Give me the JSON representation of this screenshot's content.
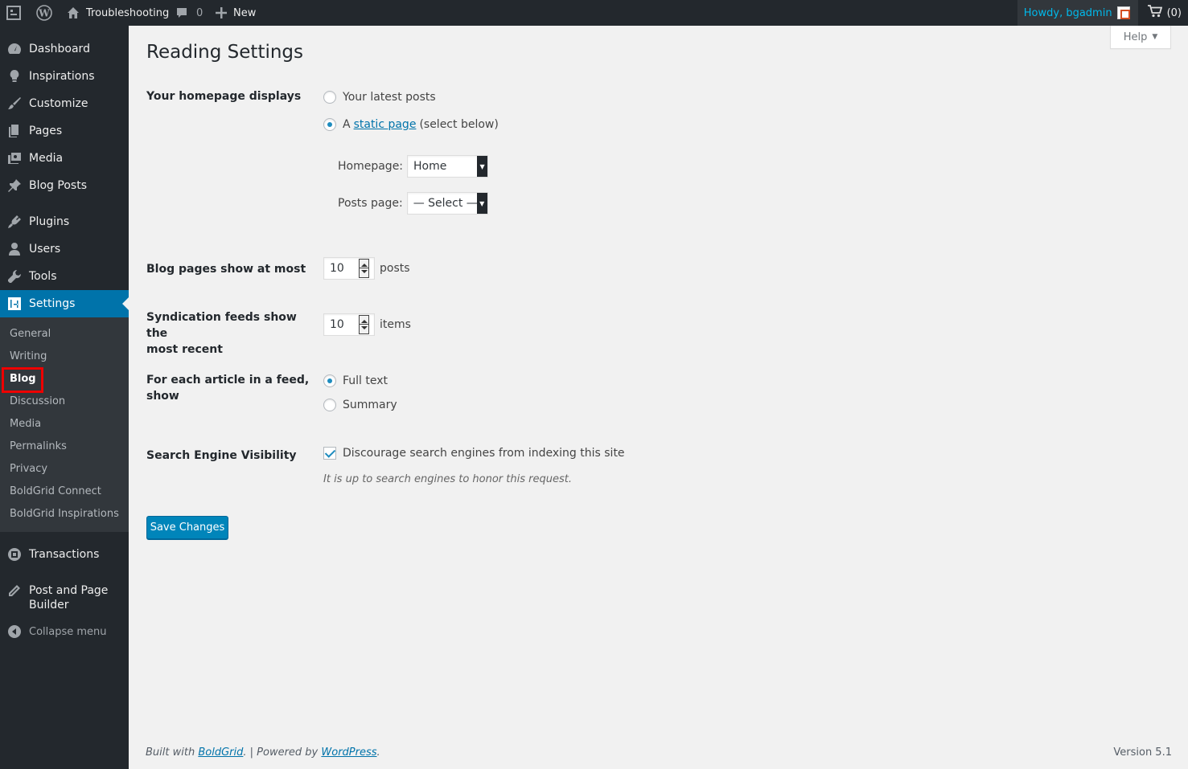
{
  "adminbar": {
    "site_name": "Troubleshooting",
    "comments_count": "0",
    "new_label": "New",
    "howdy": "Howdy, bgadmin",
    "cart_count": "(0)"
  },
  "sidebar": {
    "items": [
      {
        "label": "Dashboard",
        "icon": "dashboard-icon"
      },
      {
        "label": "Inspirations",
        "icon": "lightbulb-icon"
      },
      {
        "label": "Customize",
        "icon": "brush-icon"
      },
      {
        "label": "Pages",
        "icon": "pages-icon"
      },
      {
        "label": "Media",
        "icon": "media-icon"
      },
      {
        "label": "Blog Posts",
        "icon": "pin-icon"
      },
      {
        "label": "Plugins",
        "icon": "plugin-icon"
      },
      {
        "label": "Users",
        "icon": "user-icon"
      },
      {
        "label": "Tools",
        "icon": "wrench-icon"
      },
      {
        "label": "Settings",
        "icon": "settings-icon"
      }
    ],
    "submenu": [
      "General",
      "Writing",
      "Blog",
      "Discussion",
      "Media",
      "Permalinks",
      "Privacy",
      "BoldGrid Connect",
      "BoldGrid Inspirations"
    ],
    "transactions": "Transactions",
    "builder_line1": "Post and Page",
    "builder_line2": "Builder",
    "collapse": "Collapse menu"
  },
  "page": {
    "help": "Help",
    "title": "Reading Settings",
    "homepage_displays": {
      "label": "Your homepage displays",
      "opt_latest": "Your latest posts",
      "opt_static_prefix": "A",
      "opt_static_link": "static page",
      "opt_static_suffix": "(select below)",
      "homepage_label": "Homepage:",
      "homepage_value": "Home",
      "posts_page_label": "Posts page:",
      "posts_page_value": "— Select —"
    },
    "blog_pages": {
      "label": "Blog pages show at most",
      "value": "10",
      "unit": "posts"
    },
    "syndication": {
      "label_line1": "Syndication feeds show the",
      "label_line2": "most recent",
      "value": "10",
      "unit": "items"
    },
    "feed_article": {
      "label": "For each article in a feed, show",
      "opt_full": "Full text",
      "opt_summary": "Summary"
    },
    "search_visibility": {
      "label": "Search Engine Visibility",
      "checkbox": "Discourage search engines from indexing this site",
      "description": "It is up to search engines to honor this request."
    },
    "save": "Save Changes"
  },
  "footer": {
    "built_with": "Built with",
    "boldgrid": "BoldGrid",
    "powered_by": ". | Powered by",
    "wordpress": "WordPress",
    "period": ".",
    "version": "Version 5.1"
  },
  "colors": {
    "accent": "#0073aa",
    "sidebar": "#23282d",
    "highlight": "#ee0000"
  }
}
